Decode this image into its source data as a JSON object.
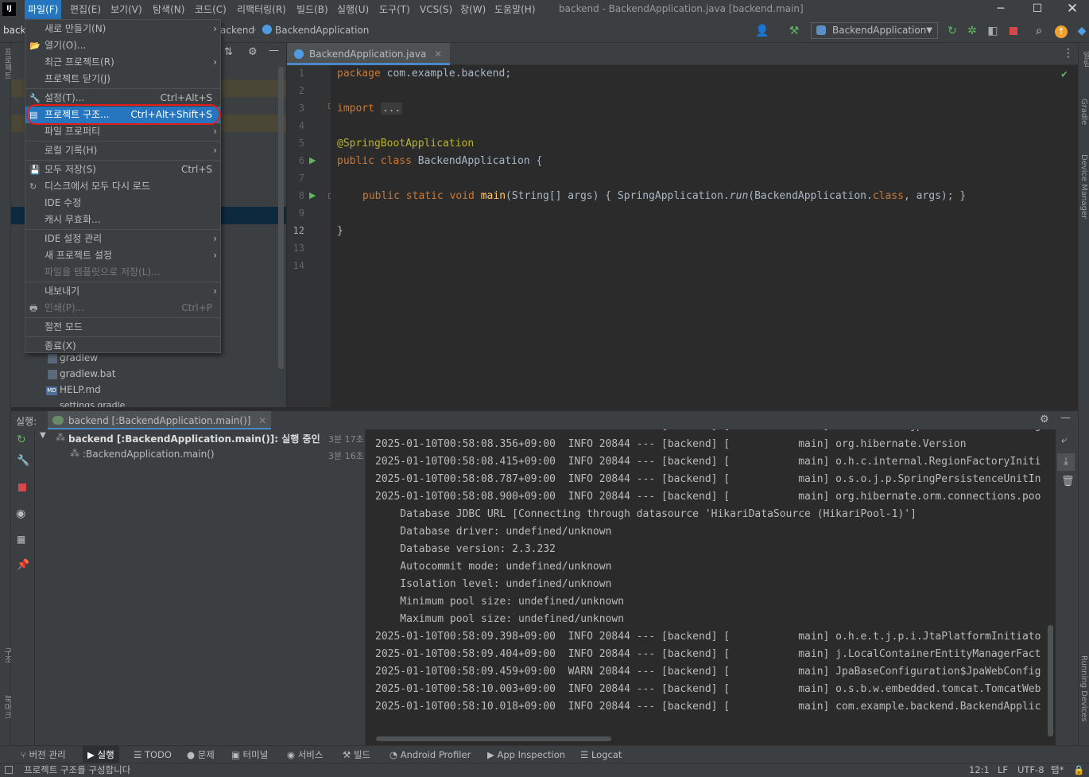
{
  "window": {
    "title": "backend - BackendApplication.java [backend.main]",
    "menus": [
      "파일(F)",
      "편집(E)",
      "보기(V)",
      "탐색(N)",
      "코드(C)",
      "리팩터링(R)",
      "빌드(B)",
      "실행(U)",
      "도구(T)",
      "VCS(S)",
      "창(W)",
      "도움말(H)"
    ]
  },
  "navbar": {
    "project_short": "back",
    "breadcrumb": [
      "ackend",
      "BackendApplication"
    ],
    "run_config": "BackendApplication"
  },
  "file_menu": {
    "items": [
      {
        "label": "새로 만들기(N)",
        "shortcut": "",
        "submenu": true
      },
      {
        "label": "열기(O)...",
        "shortcut": "",
        "submenu": false
      },
      {
        "label": "최근 프로젝트(R)",
        "shortcut": "",
        "submenu": true
      },
      {
        "label": "프로젝트 닫기(J)",
        "shortcut": "",
        "submenu": false
      },
      {
        "label": "설정(T)...",
        "shortcut": "Ctrl+Alt+S",
        "submenu": false
      },
      {
        "label": "프로젝트 구조...",
        "shortcut": "Ctrl+Alt+Shift+S",
        "submenu": false
      },
      {
        "label": "파일 프로퍼티",
        "shortcut": "",
        "submenu": true
      },
      {
        "label": "로컬 기록(H)",
        "shortcut": "",
        "submenu": true
      },
      {
        "label": "모두 저장(S)",
        "shortcut": "Ctrl+S",
        "submenu": false
      },
      {
        "label": "디스크에서 모두 다시 로드",
        "shortcut": "",
        "submenu": false
      },
      {
        "label": "IDE 수정",
        "shortcut": "",
        "submenu": false
      },
      {
        "label": "캐시 무효화...",
        "shortcut": "",
        "submenu": false
      },
      {
        "label": "IDE 설정 관리",
        "shortcut": "",
        "submenu": true
      },
      {
        "label": "새 프로젝트 설정",
        "shortcut": "",
        "submenu": true
      },
      {
        "label": "파일을 템플릿으로 저장(L)...",
        "shortcut": "",
        "submenu": false
      },
      {
        "label": "내보내기",
        "shortcut": "",
        "submenu": true
      },
      {
        "label": "인쇄(P)...",
        "shortcut": "Ctrl+P",
        "submenu": false
      },
      {
        "label": "절전 모드",
        "shortcut": "",
        "submenu": false
      },
      {
        "label": "종료(X)",
        "shortcut": "",
        "submenu": false
      }
    ]
  },
  "project_tree": {
    "items": [
      "gradlew",
      "gradlew.bat",
      "HELP.md",
      "settings.gradle"
    ]
  },
  "editor": {
    "tab": "BackendApplication.java",
    "line_numbers": [
      "1",
      "2",
      "3",
      "4",
      "5",
      "6",
      "7",
      "8",
      "9",
      "12",
      "13",
      "14"
    ],
    "code": {
      "l1_kw": "package",
      "l1_rest": " com.example.backend;",
      "l3_kw": "import",
      "l3_fold": "...",
      "l6": "@SpringBootApplication",
      "l7_kw": "public class",
      "l7_rest": " BackendApplication {",
      "l9_kw": "public static void",
      "l9_fn": "main",
      "l9_a": "(String[] args) { SpringApplication.",
      "l9_run": "run",
      "l9_b": "(BackendApplication.",
      "l9_cls": "class",
      "l9_c": ", args); }",
      "l13": "}"
    }
  },
  "run_panel": {
    "label": "실행:",
    "tab": "backend [:BackendApplication.main()]",
    "tree": [
      {
        "label": "backend [:BackendApplication.main()]: 실행 중인 작업...",
        "time": "3분 17초"
      },
      {
        "label": ":BackendApplication.main()",
        "time": "3분 16초"
      }
    ],
    "console": [
      "2025-01-10T00:58:08.356+09:00  INFO 20844 --- [backend] [           main] org.hibernate.Version",
      "2025-01-10T00:58:08.415+09:00  INFO 20844 --- [backend] [           main] o.h.c.internal.RegionFactoryIniti",
      "2025-01-10T00:58:08.787+09:00  INFO 20844 --- [backend] [           main] o.s.o.j.p.SpringPersistenceUnitIn",
      "2025-01-10T00:58:08.900+09:00  INFO 20844 --- [backend] [           main] org.hibernate.orm.connections.poo",
      "    Database JDBC URL [Connecting through datasource 'HikariDataSource (HikariPool-1)']",
      "    Database driver: undefined/unknown",
      "    Database version: 2.3.232",
      "    Autocommit mode: undefined/unknown",
      "    Isolation level: undefined/unknown",
      "    Minimum pool size: undefined/unknown",
      "    Maximum pool size: undefined/unknown",
      "2025-01-10T00:58:09.398+09:00  INFO 20844 --- [backend] [           main] o.h.e.t.j.p.i.JtaPlatformInitiato",
      "2025-01-10T00:58:09.404+09:00  INFO 20844 --- [backend] [           main] j.LocalContainerEntityManagerFact",
      "2025-01-10T00:58:09.459+09:00  WARN 20844 --- [backend] [           main] JpaBaseConfiguration$JpaWebConfig",
      "2025-01-10T00:58:10.003+09:00  INFO 20844 --- [backend] [           main] o.s.b.w.embedded.tomcat.TomcatWeb",
      "2025-01-10T00:58:10.018+09:00  INFO 20844 --- [backend] [           main] com.example.backend.BackendApplic"
    ]
  },
  "bottom_tabs": [
    "버전 관리",
    "실행",
    "TODO",
    "문제",
    "터미널",
    "서비스",
    "빌드",
    "Android Profiler",
    "App Inspection",
    "Logcat"
  ],
  "status": {
    "message": "프로젝트 구조를 구성합니다",
    "position": "12:1",
    "line_sep": "LF",
    "encoding": "UTF-8",
    "indent": "탭*"
  },
  "side_labels": {
    "right_top": "알림",
    "gradle": "Gradle",
    "device_manager": "Device Manager",
    "running_devices": "Running Devices",
    "left_structure": "구조",
    "left_bookmarks": "북마크",
    "left_project": "프로젝트"
  },
  "colors": {
    "menu_highlight": "#2675bf",
    "annotation_red": "#e21b1b",
    "keyword": "#cc7832",
    "annotation": "#bbb529",
    "function": "#ffc66d"
  }
}
